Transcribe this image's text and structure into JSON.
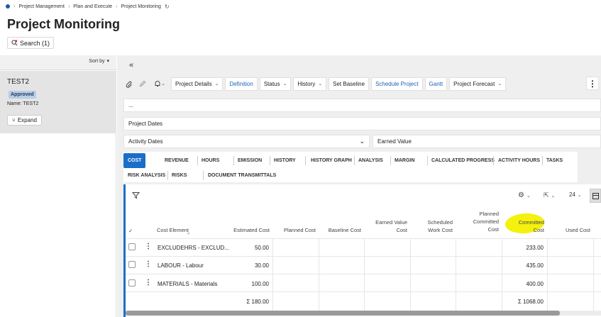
{
  "breadcrumb": [
    "Project Management",
    "Plan and Execute",
    "Project Monitoring"
  ],
  "page": {
    "title": "Project Monitoring"
  },
  "search": {
    "label": "Search (1)"
  },
  "sidebar": {
    "sort_label": "Sort by",
    "card": {
      "title": "TEST2",
      "status": "Approved",
      "name_label": "Name:",
      "name_value": "TEST2",
      "expand_label": "Expand"
    }
  },
  "toolbar": {
    "project_details": "Project Details",
    "definition": "Definition",
    "status": "Status",
    "history": "History",
    "set_baseline": "Set Baseline",
    "schedule_project": "Schedule Project",
    "gantt": "Gantt",
    "project_forecast": "Project Forecast"
  },
  "sections": {
    "ellipsis": "...",
    "project_dates": "Project Dates",
    "activity_dates": "Activity Dates",
    "earned_value": "Earned Value"
  },
  "tabs": {
    "row1": [
      "COST",
      "REVENUE",
      "HOURS",
      "EMISSION",
      "HISTORY",
      "HISTORY GRAPH",
      "ANALYSIS",
      "MARGIN",
      "CALCULATED PROGRESS",
      "ACTIVITY HOURS",
      "TASKS"
    ],
    "row2": [
      "RISK ANALYSIS",
      "RISKS",
      "DOCUMENT TRANSMITTALS"
    ],
    "active": "COST"
  },
  "table": {
    "page_size": "24",
    "columns": {
      "cost_element": "Cost Element",
      "estimated_cost": "Estimated Cost",
      "planned_cost": "Planned Cost",
      "baseline_cost": "Baseline Cost",
      "earned_value_cost_1": "Earned Value",
      "earned_value_cost_2": "Cost",
      "scheduled_work_cost_1": "Scheduled",
      "scheduled_work_cost_2": "Work Cost",
      "planned_committed_1": "Planned",
      "planned_committed_2": "Committed",
      "planned_committed_3": "Cost",
      "committed_cost_1": "Committed",
      "committed_cost_2": "Cost",
      "used_cost": "Used Cost"
    },
    "rows": [
      {
        "element": "EXCLUDEHRS - EXCLUD...",
        "estimated": "50.00",
        "committed": "233.00"
      },
      {
        "element": "LABOUR - Labour",
        "estimated": "30.00",
        "committed": "435.00"
      },
      {
        "element": "MATERIALS - Materials",
        "estimated": "100.00",
        "committed": "400.00"
      }
    ],
    "totals": {
      "estimated": "Σ 180.00",
      "committed": "Σ 1068.00"
    },
    "highlight_color": "#f4f10e"
  }
}
